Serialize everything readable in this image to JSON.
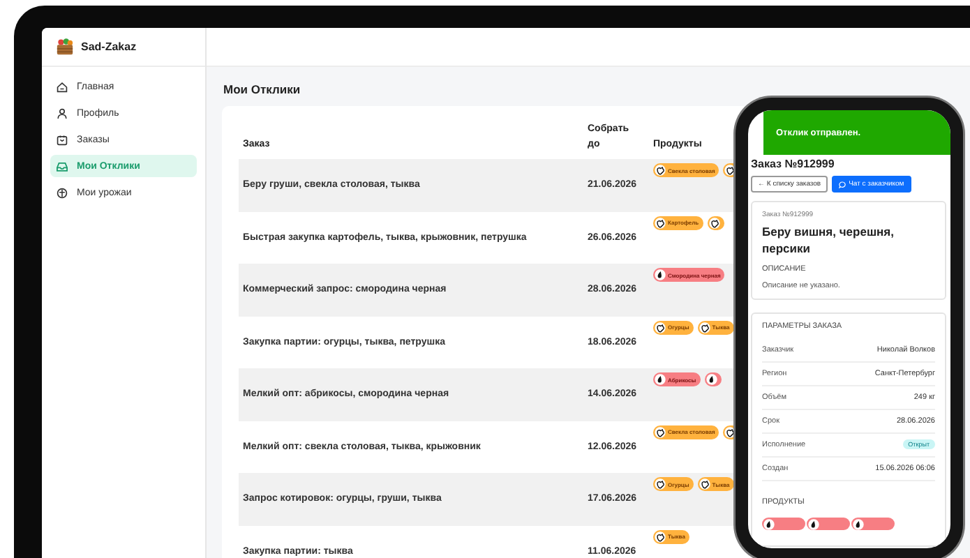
{
  "brand": "Sad-Zakaz",
  "sidebar": {
    "items": [
      {
        "label": "Главная",
        "kind": "home",
        "selected": false
      },
      {
        "label": "Профиль",
        "kind": "user",
        "selected": false
      },
      {
        "label": "Заказы",
        "kind": "orders",
        "selected": false
      },
      {
        "label": "Мои Отклики",
        "kind": "inbox",
        "selected": true
      },
      {
        "label": "Мои урожаи",
        "kind": "harvest",
        "selected": false
      }
    ]
  },
  "page_title": "Мои Отклики",
  "table": {
    "columns": [
      "Заказ",
      "Собрать до",
      "Продукты"
    ],
    "rows": [
      {
        "title": "Беру груши, свекла столовая, тыква",
        "date": "21.06.2026",
        "products": [
          {
            "kind": "vegetable",
            "label": "Свекла столовая"
          },
          {
            "kind": "vegetable"
          }
        ]
      },
      {
        "title": "Быстрая закупка картофель, тыква, крыжовник, петрушка",
        "date": "26.06.2026",
        "products": [
          {
            "kind": "vegetable",
            "label": "Картофель"
          },
          {
            "kind": "vegetable"
          }
        ]
      },
      {
        "title": "Коммерческий запрос: смородина черная",
        "date": "28.06.2026",
        "products": [
          {
            "kind": "fruit",
            "label": "Смородина черная"
          }
        ]
      },
      {
        "title": "Закупка партии: огурцы, тыква, петрушка",
        "date": "18.06.2026",
        "products": [
          {
            "kind": "vegetable",
            "label": "Огурцы"
          },
          {
            "kind": "vegetable",
            "label": "Тыква"
          }
        ]
      },
      {
        "title": "Мелкий опт: абрикосы, смородина черная",
        "date": "14.06.2026",
        "products": [
          {
            "kind": "fruit",
            "label": "Абрикосы"
          },
          {
            "kind": "fruit"
          }
        ]
      },
      {
        "title": "Мелкий опт: свекла столовая, тыква, крыжовник",
        "date": "12.06.2026",
        "products": [
          {
            "kind": "vegetable",
            "label": "Свекла столовая"
          },
          {
            "kind": "vegetable"
          }
        ]
      },
      {
        "title": "Запрос котировок: огурцы, груши, тыква",
        "date": "17.06.2026",
        "products": [
          {
            "kind": "vegetable",
            "label": "Огурцы"
          },
          {
            "kind": "vegetable",
            "label": "Тыква"
          }
        ]
      },
      {
        "title": "Закупка партии: тыква",
        "date": "11.06.2026",
        "products": [
          {
            "kind": "vegetable",
            "label": "Тыква"
          }
        ]
      }
    ]
  },
  "phone": {
    "toast": "Отклик отправлен.",
    "heading": "Заказ №912999",
    "back_button": "← К списку заказов",
    "chat_button": "Чат с заказчиком",
    "card": {
      "number": "Заказ №912999",
      "title": "Беру вишня, черешня, персики",
      "section": "ОПИСАНИЕ",
      "text": "Описание не указано."
    },
    "params": {
      "title": "ПАРАМЕТРЫ ЗАКАЗА",
      "rows": [
        {
          "label": "Заказчик",
          "value": "Николай Волков",
          "kind": "text"
        },
        {
          "label": "Регион",
          "value": "Санкт-Петербург",
          "kind": "text"
        },
        {
          "label": "Объём",
          "value": "249 кг",
          "kind": "text"
        },
        {
          "label": "Срок",
          "value": "28.06.2026",
          "kind": "text"
        },
        {
          "label": "Исполнение",
          "value": "Открыт",
          "kind": "badge"
        },
        {
          "label": "Создан",
          "value": "15.06.2026 06:06",
          "kind": "text"
        }
      ]
    },
    "products": {
      "title": "ПРОДУКТЫ",
      "items": [
        {
          "kind": "fruit"
        },
        {
          "kind": "fruit"
        },
        {
          "kind": "fruit"
        }
      ]
    }
  }
}
